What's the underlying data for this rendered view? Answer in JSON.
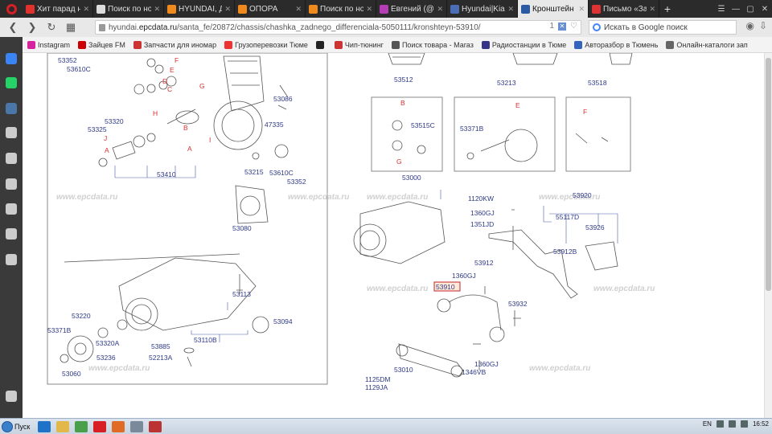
{
  "browser": {
    "tabs": [
      {
        "title": "Хит парад на",
        "color": "#e0312d"
      },
      {
        "title": "Поиск по ном",
        "color": "#dddddd"
      },
      {
        "title": "HYUNDAI, Да",
        "color": "#f08a1c"
      },
      {
        "title": "ОПОРА",
        "color": "#f08a1c"
      },
      {
        "title": "Поиск по ном",
        "color": "#f08a1c"
      },
      {
        "title": "Евгений (@ev",
        "color": "#b43cb4"
      },
      {
        "title": "Hyundai|Kia 5",
        "color": "#4a6db5"
      },
      {
        "title": "Кронштейн н",
        "color": "#2b5aa5",
        "active": true
      },
      {
        "title": "Письмо «Зак",
        "color": "#d33"
      }
    ],
    "url_prefix": "hyundai.",
    "url_host": "epcdata.ru",
    "url_path": "/santa_fe/20872/chassis/chashka_zadnego_differenciala-5050111/kronshteyn-53910/",
    "page_count": "1",
    "search_placeholder": "Искать в Google поиск",
    "bookmarks": [
      {
        "label": "Instagram",
        "color": "#d6249f"
      },
      {
        "label": "Зайцев FM",
        "color": "#c00"
      },
      {
        "label": "Запчасти для иномар",
        "color": "#c33"
      },
      {
        "label": "Грузоперевозки Тюме",
        "color": "#e33"
      },
      {
        "label": "",
        "color": "#222"
      },
      {
        "label": "Чип-тюнинг",
        "color": "#c33"
      },
      {
        "label": "Поиск товара - Магаз",
        "color": "#555"
      },
      {
        "label": "Радиостанции в Тюме",
        "color": "#338"
      },
      {
        "label": "Авторазбор в Тюмень",
        "color": "#36b"
      },
      {
        "label": "Онлайн-каталоги зап",
        "color": "#666"
      }
    ]
  },
  "sidebar_icons": [
    {
      "name": "messenger-icon",
      "color": "#3b84f5"
    },
    {
      "name": "whatsapp-icon",
      "color": "#25d366"
    },
    {
      "name": "vk-icon",
      "color": "#4a76a8"
    },
    {
      "name": "camera-icon",
      "color": "#cccccc"
    },
    {
      "name": "grid-icon",
      "color": "#cccccc"
    },
    {
      "name": "heart-icon",
      "color": "#cccccc"
    },
    {
      "name": "news-icon",
      "color": "#cccccc"
    },
    {
      "name": "history-icon",
      "color": "#cccccc"
    },
    {
      "name": "settings-icon",
      "color": "#cccccc"
    }
  ],
  "diagram": {
    "watermark": "www.epcdata.ru",
    "labels_blue": [
      "53352",
      "53610C",
      "53320",
      "53325",
      "53410",
      "53086",
      "47335",
      "53215",
      "53610C",
      "53352",
      "53080",
      "53113",
      "53220",
      "53371B",
      "53320A",
      "53236",
      "53060",
      "53885",
      "52213A",
      "53110B",
      "53094",
      "53512",
      "53515C",
      "53213",
      "53371B",
      "53518",
      "53000",
      "1120KW",
      "53920",
      "1360GJ",
      "55117D",
      "1351JD",
      "53926",
      "53912B",
      "53912",
      "1360GJ",
      "53910",
      "53932",
      "53010",
      "1360GJ",
      "1346VB",
      "1125DM",
      "1129JA"
    ],
    "labels_red": [
      "F",
      "E",
      "D",
      "C",
      "G",
      "H",
      "B",
      "A",
      "I",
      "J",
      "A",
      "B",
      "G",
      "E",
      "F"
    ],
    "highlight": "53910"
  },
  "taskbar": {
    "start_label": "Пуск",
    "apps": [
      {
        "name": "ie-icon",
        "color": "#1e73c8"
      },
      {
        "name": "explorer-icon",
        "color": "#e2b84a"
      },
      {
        "name": "media-icon",
        "color": "#4a9f4a"
      },
      {
        "name": "opera-icon",
        "color": "#d91f26"
      },
      {
        "name": "paint-icon",
        "color": "#e06b24"
      },
      {
        "name": "calc-icon",
        "color": "#7a8a9a"
      },
      {
        "name": "app-icon",
        "color": "#b33"
      }
    ],
    "lang": "EN",
    "time": "16:52"
  }
}
